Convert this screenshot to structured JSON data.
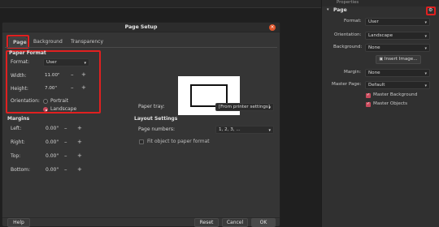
{
  "dialog": {
    "title": "Page Setup",
    "tabs": [
      {
        "label": "Page"
      },
      {
        "label": "Background"
      },
      {
        "label": "Transparency"
      }
    ],
    "paper_format": {
      "section_title": "Paper Format",
      "format_label": "Format:",
      "format_value": "User",
      "width_label": "Width:",
      "width_value": "11.00\"",
      "height_label": "Height:",
      "height_value": "7.00\"",
      "orientation_label": "Orientation:",
      "portrait_label": "Portrait",
      "landscape_label": "Landscape",
      "selected_orientation": "Landscape"
    },
    "margins": {
      "section_title": "Margins",
      "left_label": "Left:",
      "left_value": "0.00\"",
      "right_label": "Right:",
      "right_value": "0.00\"",
      "top_label": "Top:",
      "top_value": "0.00\"",
      "bottom_label": "Bottom:",
      "bottom_value": "0.00\""
    },
    "paper_tray_label": "Paper tray:",
    "paper_tray_value": "[From printer settings]",
    "layout_settings": {
      "section_title": "Layout Settings",
      "page_numbers_label": "Page numbers:",
      "page_numbers_value": "1, 2, 3, ...",
      "fit_object_label": "Fit object to paper format"
    },
    "buttons": {
      "help": "Help",
      "reset": "Reset",
      "cancel": "Cancel",
      "ok": "OK"
    }
  },
  "properties": {
    "header": "Properties",
    "section": "Page",
    "format_label": "Format:",
    "format_value": "User",
    "orientation_label": "Orientation:",
    "orientation_value": "Landscape",
    "background_label": "Background:",
    "background_value": "None",
    "insert_image_label": "Insert Image...",
    "margin_label": "Margin:",
    "margin_value": "None",
    "master_page_label": "Master Page:",
    "master_page_value": "Default",
    "master_background_label": "Master Background",
    "master_objects_label": "Master Objects"
  },
  "colors": {
    "accent": "#c94a5c",
    "highlight": "#e02020",
    "close": "#e0552b"
  }
}
